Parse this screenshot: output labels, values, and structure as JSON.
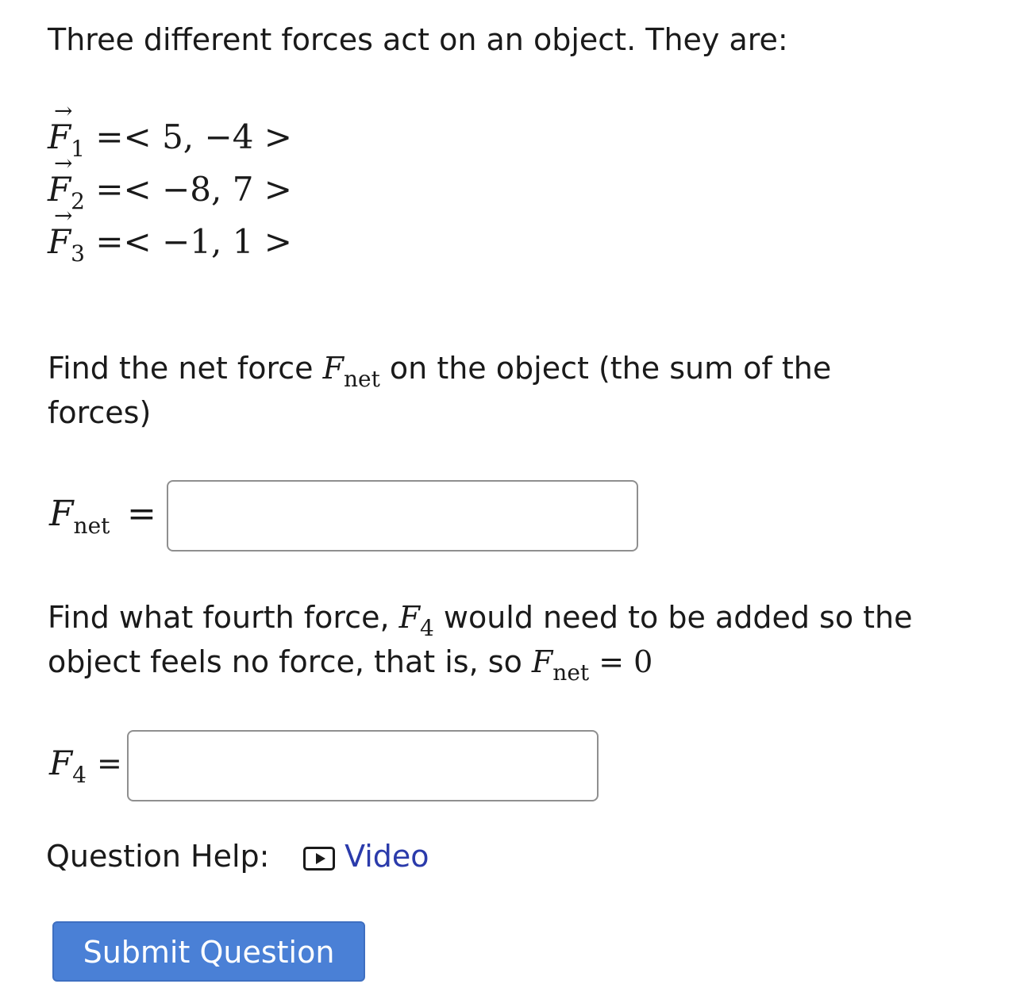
{
  "intro": "Three different forces act on an object. They are:",
  "forces": [
    {
      "letter": "F",
      "sub": "1",
      "eq": "=< 5, −4 >"
    },
    {
      "letter": "F",
      "sub": "2",
      "eq": "=< −8, 7 >"
    },
    {
      "letter": "F",
      "sub": "3",
      "eq": "=< −1, 1 >"
    }
  ],
  "arrow_glyph": "⃗",
  "q1": {
    "text_before": "Find the net force ",
    "sym": "F",
    "sym_sub": "net",
    "text_after": " on the object (the sum of the",
    "line2": "forces)"
  },
  "fnet_label": {
    "sym": "F",
    "sub": "net",
    "eq": "=",
    "value": ""
  },
  "q2": {
    "text_before": "Find what fourth force, ",
    "sym": "F",
    "sym_sub": "4",
    "text_after": " would need to be added so the",
    "line2_before": "object feels no force, that is, so ",
    "line2_sym": "F",
    "line2_sub": "net",
    "line2_eq": " = 0"
  },
  "f4_label": {
    "sym": "F",
    "sub": "4",
    "eq": "=",
    "value": ""
  },
  "help": {
    "label": "Question Help:",
    "video_icon": "play-video-icon",
    "video_label": "Video"
  },
  "submit_label": "Submit Question",
  "colors": {
    "link": "#2b3bab",
    "button": "#4a80d6",
    "border": "#8f8f8f"
  }
}
